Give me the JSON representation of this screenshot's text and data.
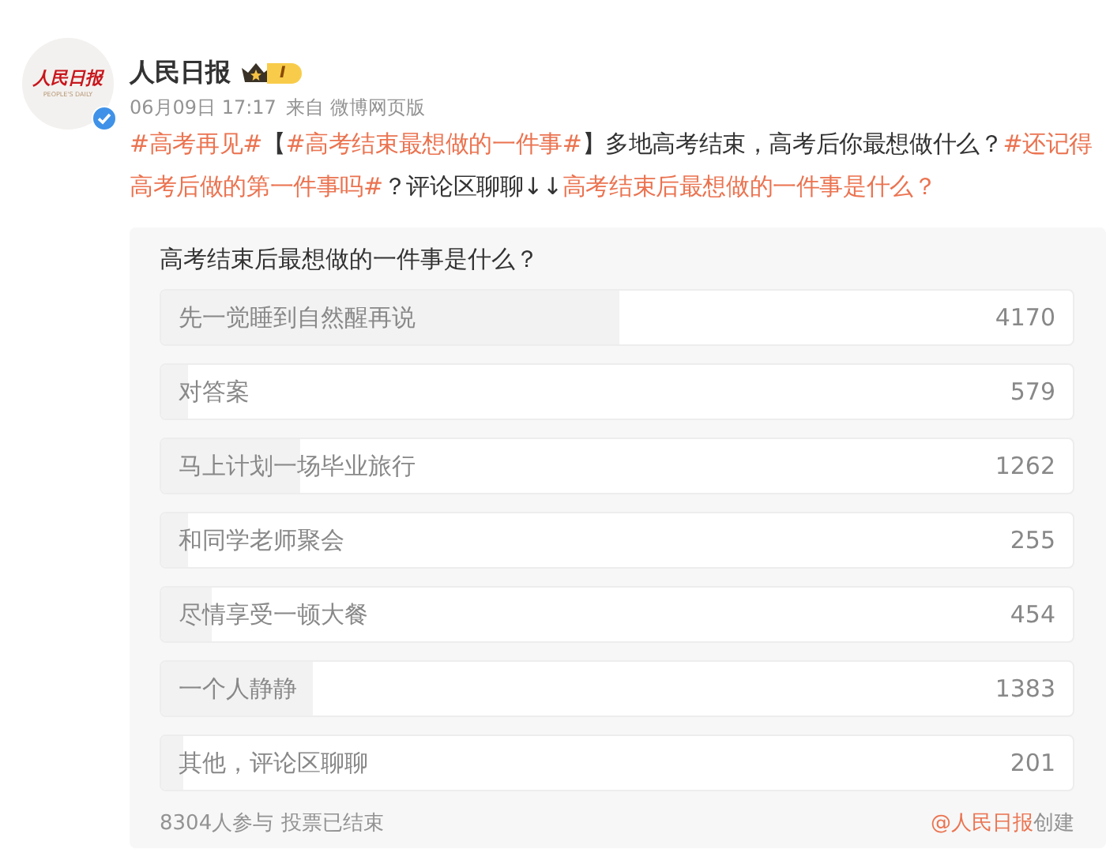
{
  "author": {
    "logo_title": "人民日报",
    "logo_subtitle": "PEOPLE'S DAILY",
    "verified": true,
    "name": "人民日报",
    "level_badge": "I",
    "time": "06月09日 17:17",
    "source": "来自 微博网页版"
  },
  "post": {
    "segments": [
      {
        "kind": "topic",
        "text": "#高考再见#"
      },
      {
        "kind": "text",
        "text": "【"
      },
      {
        "kind": "topic",
        "text": "#高考结束最想做的一件事#"
      },
      {
        "kind": "text",
        "text": "】多地高考结束，高考后你最想做什么？"
      },
      {
        "kind": "topic",
        "text": "#还记得高考后做的第一件事吗#"
      },
      {
        "kind": "text",
        "text": "？评论区聊聊↓↓"
      },
      {
        "kind": "topic",
        "text": "高考结束后最想做的一件事是什么？"
      }
    ]
  },
  "poll": {
    "question": "高考结束后最想做的一件事是什么？",
    "options": [
      {
        "label": "先一觉睡到自然醒再说",
        "count": "4170",
        "level": 0.502
      },
      {
        "label": "对答案",
        "count": "579",
        "level": 0.03
      },
      {
        "label": "马上计划一场毕业旅行",
        "count": "1262",
        "level": 0.152
      },
      {
        "label": "和同学老师聚会",
        "count": "255",
        "level": 0.03
      },
      {
        "label": "尽情享受一顿大餐",
        "count": "454",
        "level": 0.055
      },
      {
        "label": "一个人静静",
        "count": "1383",
        "level": 0.167
      },
      {
        "label": "其他，评论区聊聊",
        "count": "201",
        "level": 0.024
      }
    ],
    "participants": "8304人参与",
    "status": "投票已结束",
    "creator": "@人民日报",
    "created": "创建"
  }
}
